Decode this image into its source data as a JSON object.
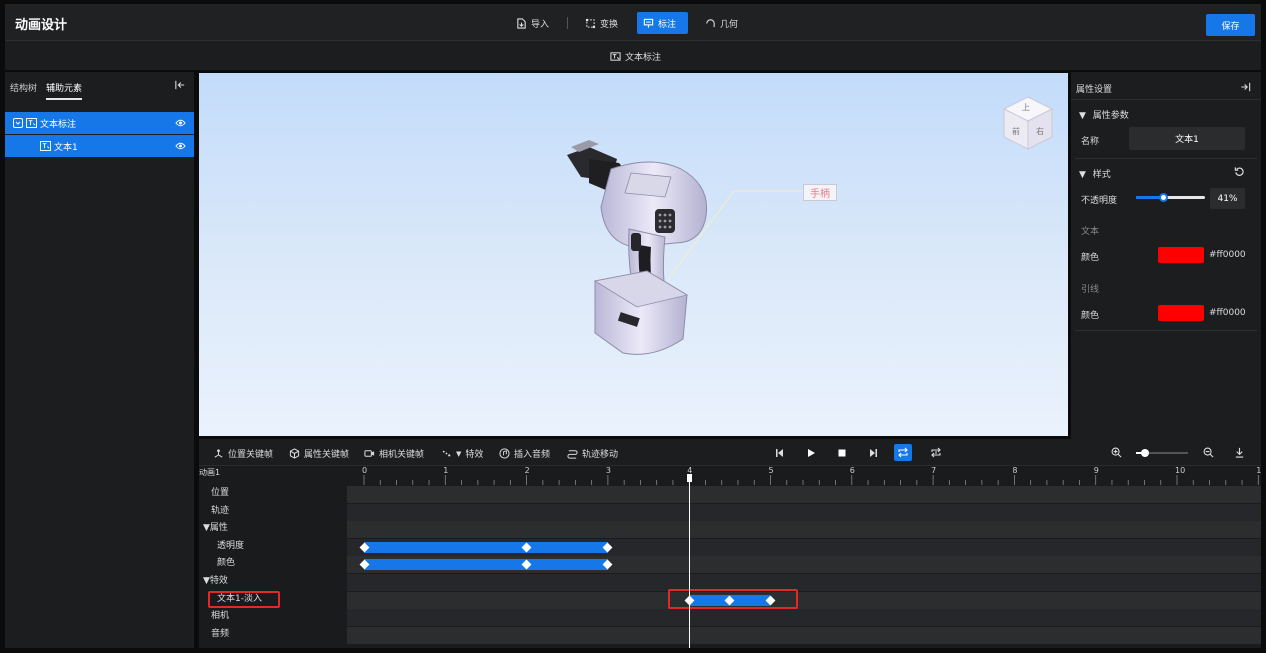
{
  "app": {
    "title": "动画设计",
    "save_label": "保存"
  },
  "toolbar": {
    "items": [
      {
        "label": "导入",
        "icon": "import-icon",
        "active": false
      },
      {
        "label": "变换",
        "icon": "transform-icon",
        "active": false
      },
      {
        "label": "标注",
        "icon": "annotate-icon",
        "active": true
      },
      {
        "label": "几何",
        "icon": "geometry-icon",
        "active": false
      }
    ]
  },
  "subtitle": {
    "label": "文本标注",
    "icon": "text-annotation-icon"
  },
  "left_panel": {
    "tabs": [
      {
        "label": "结构树",
        "selected": false
      },
      {
        "label": "辅助元素",
        "selected": true
      }
    ],
    "tree": [
      {
        "label": "文本标注",
        "level": 0
      },
      {
        "label": "文本1",
        "level": 1
      }
    ]
  },
  "viewport": {
    "label_text": "手柄",
    "view_cube": {
      "top": "上",
      "front": "前",
      "right": "右"
    }
  },
  "right_panel": {
    "title": "属性设置",
    "params_section": "属性参数",
    "name_label": "名称",
    "name_value": "文本1",
    "style_section": "样式",
    "opacity_label": "不透明度",
    "opacity_value": "41%",
    "opacity_fraction": 0.41,
    "text_group": "文本",
    "text_color_label": "颜色",
    "text_color_hex": "#ff0000",
    "leader_group": "引线",
    "leader_color_label": "颜色",
    "leader_color_hex": "#ff0000"
  },
  "timeline": {
    "toolbar": {
      "position_keyframe": "位置关键帧",
      "property_keyframe": "属性关键帧",
      "camera_keyframe": "相机关键帧",
      "effects": "特效",
      "insert_audio": "插入音频",
      "path_move": "轨迹移动"
    },
    "animation_name": "动画1",
    "ticks": [
      "0",
      "1",
      "2",
      "3",
      "4",
      "5",
      "6",
      "7",
      "8",
      "9",
      "10",
      "1"
    ],
    "playhead_time": 4,
    "tracks": [
      {
        "label": "位置"
      },
      {
        "label": "轨迹"
      },
      {
        "label": "▼属性"
      },
      {
        "label": "透明度",
        "keys": [
          0,
          2,
          3
        ]
      },
      {
        "label": "颜色",
        "keys": [
          0,
          2,
          3
        ]
      },
      {
        "label": "▼特效"
      },
      {
        "label": "文本1-淡入",
        "keys": [
          4,
          4.5,
          5
        ]
      },
      {
        "label": "相机"
      },
      {
        "label": "音频"
      }
    ]
  },
  "colors": {
    "accent": "#1677e8",
    "highlight_red": "#e22828",
    "swatch": "#ff0000"
  }
}
